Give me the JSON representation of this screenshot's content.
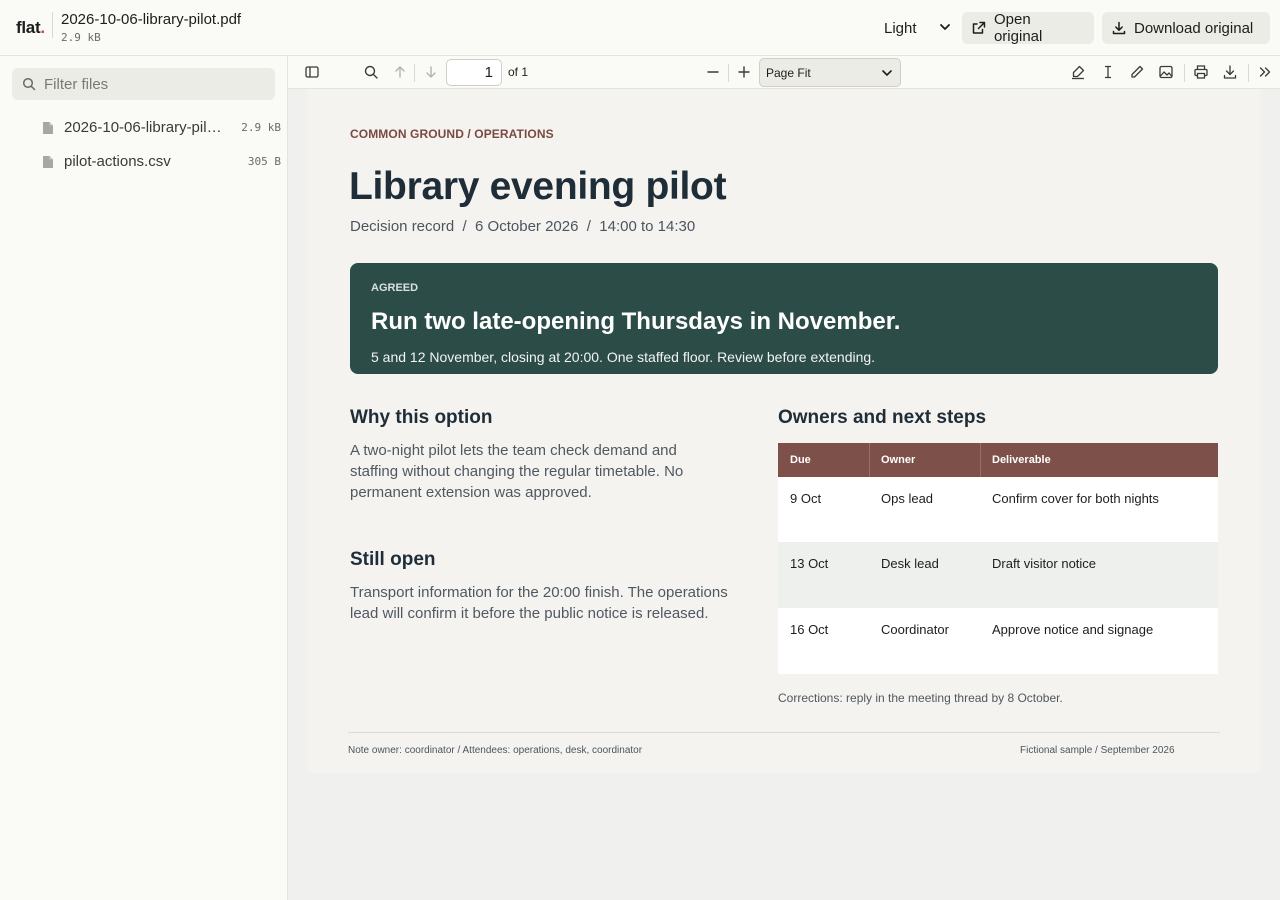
{
  "app": {
    "logo": "flat",
    "logo_dot": ".",
    "file_title": "2026-10-06-library-pilot.pdf",
    "file_size": "2.9 kB"
  },
  "header": {
    "theme_value": "Light",
    "open_label": "Open original",
    "download_label": "Download original"
  },
  "sidebar": {
    "filter_placeholder": "Filter files",
    "files": [
      {
        "name": "2026-10-06-library-pilot.pdf",
        "size": "2.9 kB",
        "active": true
      },
      {
        "name": "pilot-actions.csv",
        "size": "305 B",
        "active": false
      }
    ]
  },
  "viewer_toolbar": {
    "page_number": "1",
    "page_count": "of 1",
    "zoom_value": "Page Fit",
    "icons": [
      "sidebar-toggle-icon",
      "search-icon",
      "arrow-up-icon",
      "arrow-down-icon",
      "zoom-out-icon",
      "zoom-in-icon",
      "highlight-icon",
      "text-cursor-icon",
      "pencil-icon",
      "image-icon",
      "print-icon",
      "download-icon",
      "more-tools-icon"
    ]
  },
  "document": {
    "eyebrow": "COMMON GROUND / OPERATIONS",
    "title": "Library evening pilot",
    "meta": "Decision record  /  6 October 2026  /  14:00 to 14:30",
    "agreed": {
      "tag": "AGREED",
      "headline": "Run two late-opening Thursdays in November.",
      "detail": "5 and 12 November, closing at 20:00. One staffed floor. Review before extending."
    },
    "why": {
      "heading": "Why this option",
      "body": "A two-night pilot lets the team check demand and staffing without changing the regular timetable. No permanent extension was approved."
    },
    "open": {
      "heading": "Still open",
      "body": "Transport information for the 20:00 finish. The operations lead will confirm it before the public notice is released."
    },
    "owners": {
      "heading": "Owners and next steps",
      "columns": [
        "Due",
        "Owner",
        "Deliverable"
      ],
      "rows": [
        [
          "9 Oct",
          "Ops lead",
          "Confirm cover for both nights"
        ],
        [
          "13 Oct",
          "Desk lead",
          "Draft visitor notice"
        ],
        [
          "16 Oct",
          "Coordinator",
          "Approve notice and signage"
        ]
      ]
    },
    "corrections": "Corrections: reply in the meeting thread by 8 October.",
    "footer_left": "Note owner: coordinator / Attendees: operations, desk, coordinator",
    "footer_right": "Fictional sample / September 2026"
  },
  "colors": {
    "agreed_bg": "#2c4c48",
    "table_header": "#7d5049",
    "eyebrow": "#7a4a42",
    "title": "#1e2d38",
    "row_alt": "#eef0ee"
  }
}
